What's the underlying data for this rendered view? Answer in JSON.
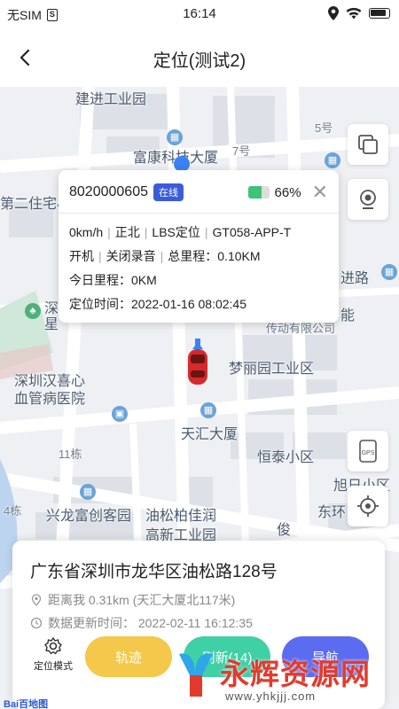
{
  "status_bar": {
    "carrier": "无SIM",
    "sim_icon": "S",
    "time": "16:14"
  },
  "nav": {
    "title": "定位(测试2)"
  },
  "map": {
    "labels": {
      "jianjin": "建进工业园",
      "fukang": "富康科技大厦",
      "seven": "7号",
      "five": "5号",
      "dierzhu": "第二住宅小",
      "shenzhen_left": "深",
      "xing": "星",
      "hanxi1": "深圳汉喜心",
      "hanxi2": "血管病医院",
      "menglivuan": "梦丽园工业区",
      "tianhui": "天汇大厦",
      "hengtai": "恒泰小区",
      "eleven": "11栋",
      "xinglong": "兴龙富创客园",
      "yousong1": "油松柏佳润",
      "yousong2": "高新工业园",
      "four": "4栋",
      "jinlu": "进路",
      "chuandong": "传动有限公司",
      "neng": "能",
      "xudan": "旭日小区",
      "dongyuan": "东环",
      "jun": "俊"
    }
  },
  "info_card": {
    "device_id": "8020000605",
    "status": "在线",
    "battery_pct": 66,
    "battery_text": "66%",
    "close": "✕",
    "speed": "0km/h",
    "direction": "正北",
    "loc_type": "LBS定位",
    "model": "GT058-APP-T",
    "power": "开机",
    "recording": "关闭录音",
    "total_mileage": "总里程：0.10KM",
    "today_mileage": "今日里程：0KM",
    "locate_time": "定位时间：2022-01-16 08:02:45"
  },
  "bottom": {
    "address": "广东省深圳市龙华区油松路128号",
    "distance": "距离我 0.31km (天汇大厦北117米)",
    "updated": "数据更新时间：   2022-02-11 16:12:35",
    "mode_label": "定位模式",
    "track_label": "轨迹",
    "refresh_label": "刷新(14)",
    "nav_label": "导航"
  },
  "watermark": {
    "text": "永辉资源网",
    "url": "www.yhkjjj.com"
  },
  "baidu": "Bai百地图",
  "colors": {
    "online": "#3b5bdb",
    "track": "#f4c84a",
    "refresh": "#3fd0a6",
    "nav": "#5b6cf0",
    "battery": "#3fc27a"
  }
}
